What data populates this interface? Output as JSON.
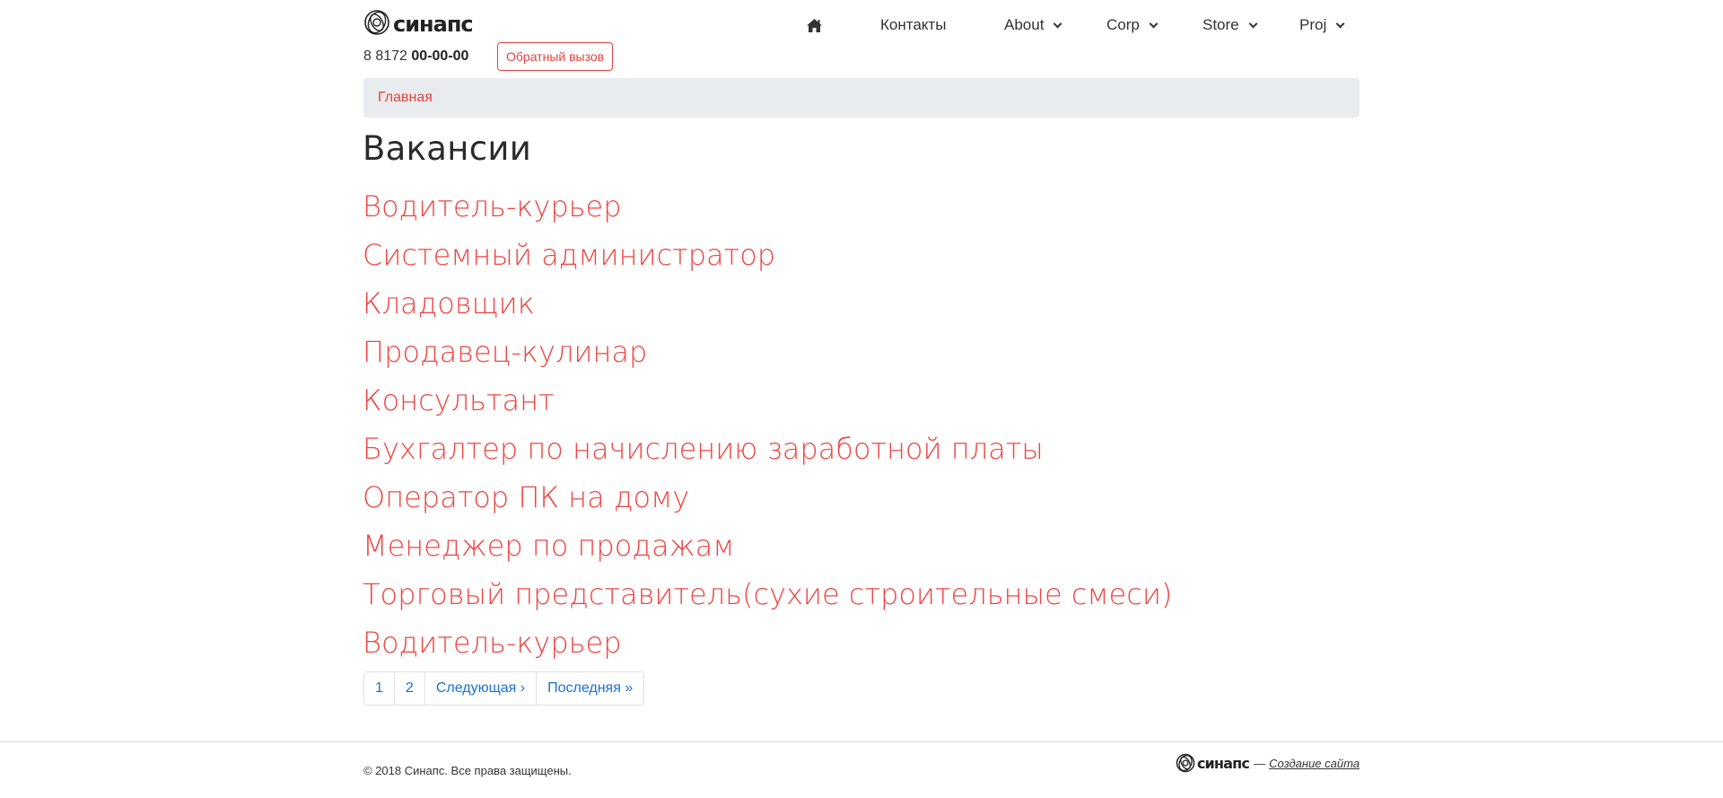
{
  "header": {
    "brand": "синапс",
    "phone_prefix": "8 8172",
    "phone_number": "00-00-00",
    "callback_label": "Обратный вызов"
  },
  "nav": {
    "home_icon": "home-icon",
    "items": [
      {
        "label": "Контакты",
        "dropdown": false
      },
      {
        "label": "About",
        "dropdown": true
      },
      {
        "label": "Corp",
        "dropdown": true
      },
      {
        "label": "Store",
        "dropdown": true
      },
      {
        "label": "Proj",
        "dropdown": true
      }
    ]
  },
  "breadcrumb": {
    "home": "Главная"
  },
  "page": {
    "title": "Вакансии",
    "jobs": [
      "Водитель-курьер",
      "Системный администратор",
      "Кладовщик",
      "Продавец-кулинар",
      "Консультант",
      "Бухгалтер по начислению заработной платы",
      "Оператор ПК на дому",
      "Менеджер по продажам",
      "Торговый представитель(сухие строительные смеси)",
      "Водитель-курьер"
    ]
  },
  "pagination": {
    "pages": [
      "1",
      "2"
    ],
    "next": "Следующая ›",
    "last": "Последняя »"
  },
  "footer": {
    "copyright": "© 2018 Синапс. Все права защищены.",
    "brand": "синапс",
    "dash": "—",
    "credit": "Создание сайта"
  },
  "colors": {
    "accent": "#ef4542",
    "link_blue": "#1a6fd9",
    "breadcrumb_bg": "#e9ecef"
  }
}
